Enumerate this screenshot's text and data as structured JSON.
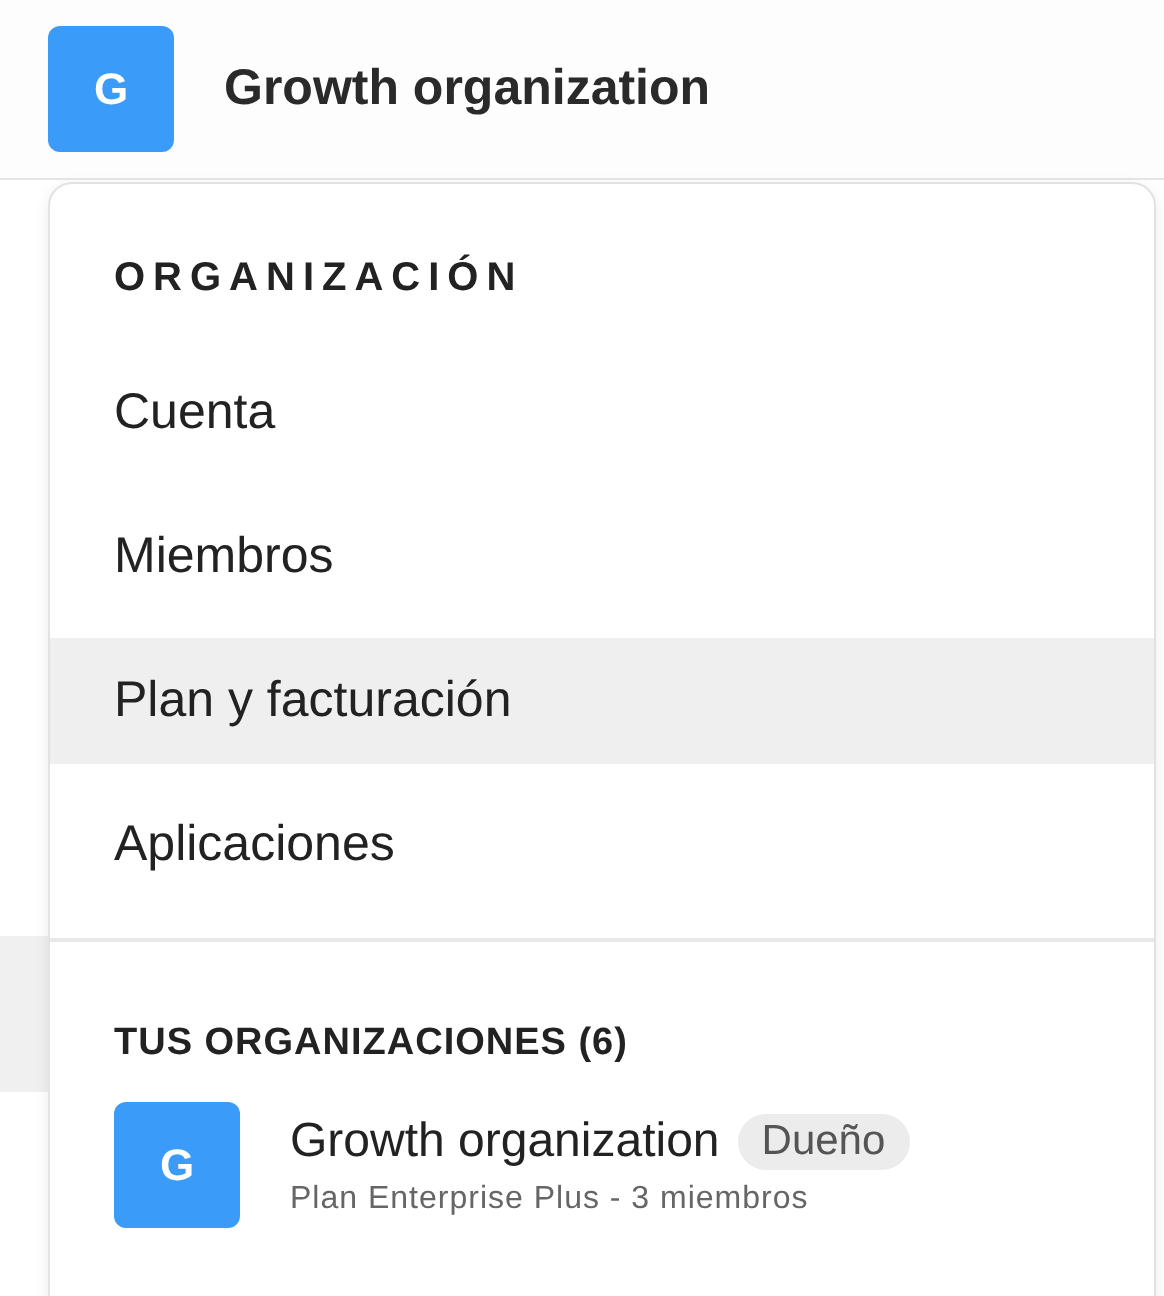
{
  "header": {
    "avatar_letter": "G",
    "title": "Growth organization"
  },
  "menu": {
    "section_title": "ORGANIZACIÓN",
    "items": [
      {
        "label": "Cuenta",
        "selected": false
      },
      {
        "label": "Miembros",
        "selected": false
      },
      {
        "label": "Plan y facturación",
        "selected": true
      },
      {
        "label": "Aplicaciones",
        "selected": false
      }
    ],
    "orgs_title": "TUS ORGANIZACIONES (6)",
    "orgs": [
      {
        "avatar_letter": "G",
        "name": "Growth organization",
        "role": "Dueño",
        "details": "Plan Enterprise Plus - 3 miembros"
      }
    ]
  }
}
